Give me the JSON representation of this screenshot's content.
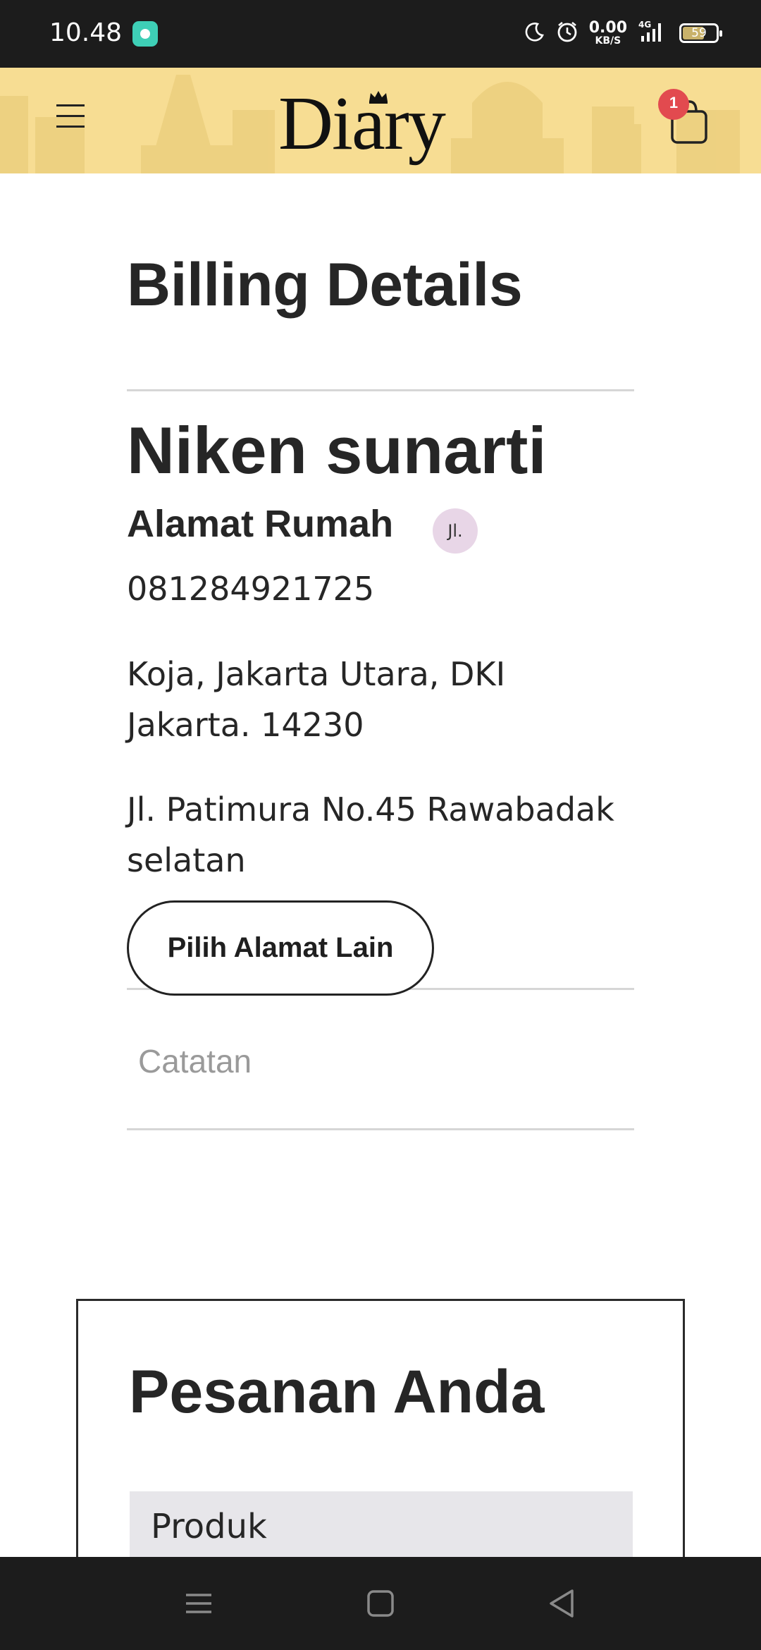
{
  "status_bar": {
    "time": "10.48",
    "network_speed_value": "0.00",
    "network_speed_unit": "KB/S",
    "network_type": "4G",
    "battery_level": "59",
    "battery_fraction": 0.59,
    "icons": [
      "app-notification-icon",
      "moon-icon",
      "alarm-icon",
      "signal-icon",
      "battery-icon"
    ]
  },
  "header": {
    "logo_text": "Diary",
    "cart_count": "1",
    "background_color": "#f7dd93",
    "badge_color": "#e24a4f",
    "menu_icon": "hamburger-menu-icon",
    "cart_icon": "shopping-bag-icon"
  },
  "billing": {
    "title": "Billing Details",
    "customer_name": "Niken sunarti",
    "address_label": "Alamat Rumah",
    "address_chip": "Jl.",
    "phone": "081284921725",
    "address_line1": "Koja, Jakarta Utara, DKI Jakarta. 14230",
    "address_line2": "Jl. Patimura No.45 Rawabadak selatan",
    "change_address_button": "Pilih Alamat Lain",
    "notes_placeholder": "Catatan",
    "notes_value": ""
  },
  "order": {
    "title": "Pesanan Anda",
    "table_header_product": "Produk"
  },
  "nav_bar": {
    "buttons": [
      "recents-icon",
      "home-icon",
      "back-icon"
    ]
  }
}
